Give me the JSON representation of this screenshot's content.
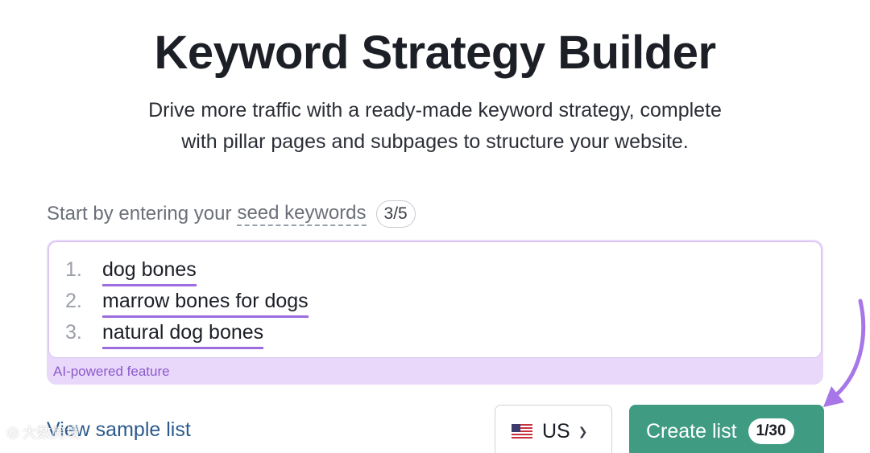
{
  "header": {
    "title": "Keyword Strategy Builder",
    "subtitle_line1": "Drive more traffic with a ready-made keyword strategy, complete",
    "subtitle_line2": "with pillar pages and subpages to structure your website."
  },
  "input": {
    "prompt_prefix": "Start by entering your",
    "prompt_link": "seed keywords",
    "count": "3/5",
    "keywords": [
      {
        "num": "1.",
        "text": "dog bones"
      },
      {
        "num": "2.",
        "text": "marrow bones for dogs"
      },
      {
        "num": "3.",
        "text": "natural dog bones"
      }
    ],
    "ai_label": "AI-powered feature"
  },
  "footer": {
    "sample_link": "View sample list",
    "country": {
      "label": "US",
      "icon": "us-flag-icon"
    },
    "create_button": {
      "label": "Create list",
      "badge": "1/30"
    }
  },
  "overlay": {
    "watermark": "大数跨境"
  },
  "colors": {
    "accent_purple": "#9b6dde",
    "button_green": "#3f9b82",
    "ai_band": "#ead8fb",
    "link_blue": "#2c5a8c"
  }
}
